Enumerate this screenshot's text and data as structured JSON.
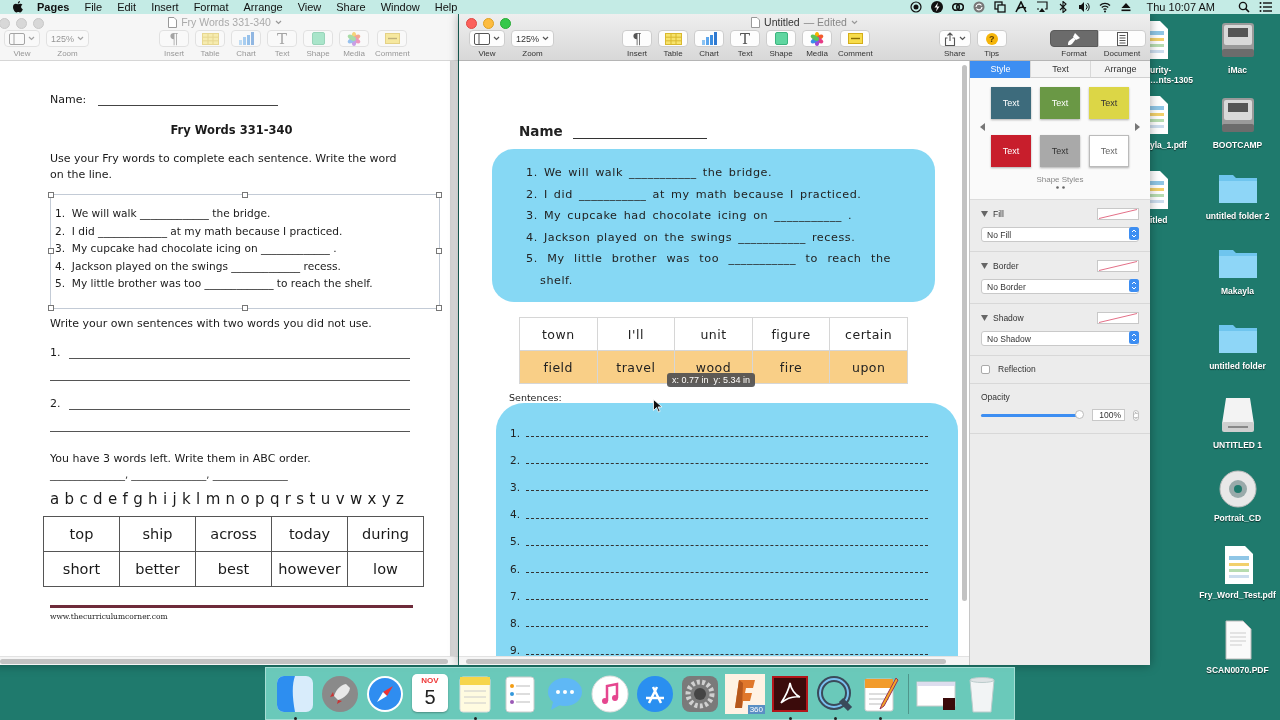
{
  "menu_bar": {
    "app": "Pages",
    "menus": [
      "File",
      "Edit",
      "Insert",
      "Format",
      "Arrange",
      "View",
      "Share",
      "Window",
      "Help"
    ],
    "clock": "Thu 10:07 AM"
  },
  "background_window": {
    "title": "Fry Words 331-340",
    "active": false,
    "toolbar": [
      [
        {
          "kind": "view",
          "label": "View"
        },
        {
          "kind": "zoom",
          "label": "Zoom",
          "value": "125%"
        }
      ],
      [
        {
          "kind": "insert",
          "label": "Insert",
          "glyph": "¶"
        },
        {
          "kind": "table",
          "label": "Table"
        },
        {
          "kind": "chart",
          "label": "Chart"
        },
        {
          "kind": "text",
          "label": "Text",
          "glyph": "T"
        },
        {
          "kind": "shape",
          "label": "Shape"
        },
        {
          "kind": "media",
          "label": "Media"
        },
        {
          "kind": "comment",
          "label": "Comment"
        }
      ]
    ],
    "worksheet": {
      "name_label": "Name:",
      "title": "Fry Words 331-340",
      "instructions": "Use your Fry words to complete each sentence.  Write the word on the line.",
      "sentences": [
        "1.  We will walk _____________ the bridge.",
        "2.  I did _____________ at my math because I practiced.",
        "3.  My cupcake had chocolate icing on _____________ .",
        "4.  Jackson played on the swings _____________ recess.",
        "5.  My little brother was too _____________ to reach the shelf."
      ],
      "own_prompt": "Write your own sentences with two words you did not use.",
      "own_lines": [
        "1.",
        "2."
      ],
      "abc_prompt": "You have 3 words left.  Write them in ABC order.",
      "abc_line": "_______________, _______________, _______________",
      "alphabet": "a b c d e f g h i j k l m n o p q r s t u v w x y z",
      "word_table": [
        [
          "top",
          "ship",
          "across",
          "today",
          "during"
        ],
        [
          "short",
          "better",
          "best",
          "however",
          "low"
        ]
      ],
      "footer": "www.thecurriculumcorner.com"
    }
  },
  "front_window": {
    "title": "Untitled",
    "status": "— Edited",
    "active": true,
    "toolbar": [
      [
        {
          "kind": "view",
          "label": "View"
        },
        {
          "kind": "zoom",
          "label": "Zoom",
          "value": "125%"
        }
      ],
      [
        {
          "kind": "insert",
          "label": "Insert",
          "glyph": "¶"
        },
        {
          "kind": "table",
          "label": "Table"
        },
        {
          "kind": "chart",
          "label": "Chart"
        },
        {
          "kind": "text",
          "label": "Text",
          "glyph": "T"
        },
        {
          "kind": "shape",
          "label": "Shape"
        },
        {
          "kind": "media",
          "label": "Media"
        },
        {
          "kind": "comment",
          "label": "Comment"
        }
      ],
      [
        {
          "kind": "share",
          "label": "Share"
        },
        {
          "kind": "tips",
          "label": "Tips",
          "glyph": "?"
        }
      ],
      [
        {
          "kind": "format",
          "label": "Format",
          "selected": true
        },
        {
          "kind": "document",
          "label": "Document",
          "selected": false
        }
      ]
    ],
    "document": {
      "name_label": "Name",
      "sentences": [
        "1. We will walk ___________ the bridge.",
        "2. I did ___________ at my math because I practiced.",
        "3. My cupcake had chocolate icing on ___________ .",
        "4. Jackson played on the swings ___________ recess.",
        "5. My little brother was too ___________ to reach the shelf."
      ],
      "word_rows": [
        {
          "cells": [
            "town",
            "I'll",
            "unit",
            "figure",
            "certain"
          ],
          "highlighted": false
        },
        {
          "cells": [
            "field",
            "travel",
            "wood",
            "fire",
            "upon"
          ],
          "highlighted": true
        }
      ],
      "tooltip": "x: 0.77 in  y: 5.34 in",
      "sentences_label": "Sentences:",
      "lines": [
        "1.",
        "2.",
        "3.",
        "4.",
        "5.",
        "6.",
        "7.",
        "8.",
        "9."
      ]
    },
    "inspector": {
      "tabs": [
        {
          "label": "Style",
          "selected": true
        },
        {
          "label": "Text",
          "selected": false
        },
        {
          "label": "Arrange",
          "selected": false
        }
      ],
      "styles": [
        {
          "label": "Text",
          "color": "#3d6b7c"
        },
        {
          "label": "Text",
          "color": "#6a9845"
        },
        {
          "label": "Text",
          "color": "#dcd646"
        },
        {
          "label": "Text",
          "color": "#c81e2c"
        },
        {
          "label": "Text",
          "color": "#a9a9a9"
        },
        {
          "label": "Text",
          "color": "#ffffff"
        }
      ],
      "styles_caption": "Shape Styles",
      "sections": [
        {
          "label": "Fill",
          "value": "No Fill",
          "expanded": true
        },
        {
          "label": "Border",
          "value": "No Border",
          "expanded": true
        },
        {
          "label": "Shadow",
          "value": "No Shadow",
          "expanded": true
        }
      ],
      "reflection": {
        "label": "Reflection",
        "checked": false
      },
      "opacity": {
        "label": "Opacity",
        "level": 1,
        "reading": "100%"
      }
    }
  },
  "partial_desktop_icons": [
    {
      "kind": "pdf",
      "label": "urity-\n…nts-1305"
    },
    {
      "kind": "pdf",
      "label": "yla_1.pdf"
    },
    {
      "kind": "pdf",
      "label": "itled"
    }
  ],
  "desktop_icons": [
    {
      "kind": "drive",
      "label": "iMac"
    },
    {
      "kind": "drive",
      "label": "BOOTCAMP"
    },
    {
      "kind": "folder",
      "label": "untitled folder 2"
    },
    {
      "kind": "folder",
      "label": "Makayla"
    },
    {
      "kind": "folder",
      "label": "untitled folder"
    },
    {
      "kind": "removable",
      "label": "UNTITLED 1"
    },
    {
      "kind": "disc",
      "label": "Portrait_CD"
    },
    {
      "kind": "pdf",
      "label": "Fry_Word_Test.pdf"
    },
    {
      "kind": "document",
      "label": "SCAN0070.PDF"
    }
  ],
  "dock": [
    {
      "kind": "finder",
      "running": true
    },
    {
      "kind": "launchpad",
      "running": false
    },
    {
      "kind": "safari",
      "running": false
    },
    {
      "kind": "calendar",
      "month": "NOV",
      "day": "5",
      "running": false
    },
    {
      "kind": "notes",
      "running": true
    },
    {
      "kind": "reminders",
      "running": false
    },
    {
      "kind": "messages",
      "running": false
    },
    {
      "kind": "music",
      "running": false
    },
    {
      "kind": "appstore",
      "running": false
    },
    {
      "kind": "settings",
      "running": false
    },
    {
      "kind": "fusion",
      "badge": "360",
      "running": false
    },
    {
      "kind": "acrobat",
      "running": true
    },
    {
      "kind": "quicktime",
      "running": true
    },
    {
      "kind": "pages",
      "running": true
    },
    {
      "kind": "separator"
    },
    {
      "kind": "document",
      "running": false
    },
    {
      "kind": "trash",
      "running": false
    }
  ]
}
